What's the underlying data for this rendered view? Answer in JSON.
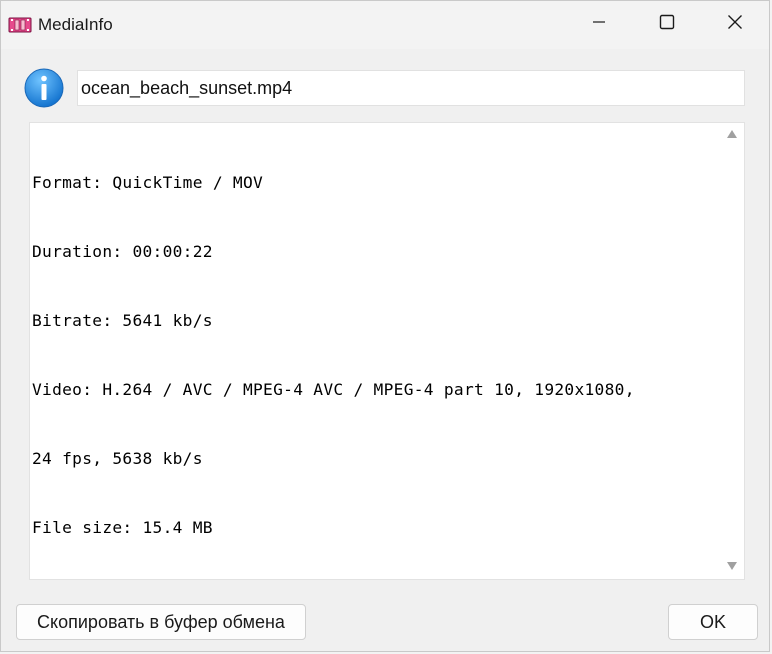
{
  "window": {
    "title": "MediaInfo"
  },
  "file": {
    "name": "ocean_beach_sunset.mp4"
  },
  "info_lines": [
    "Format: QuickTime / MOV",
    "Duration: 00:00:22",
    "Bitrate: 5641 kb/s",
    "Video: H.264 / AVC / MPEG-4 AVC / MPEG-4 part 10, 1920x1080,",
    "24 fps, 5638 kb/s",
    "File size: 15.4 MB"
  ],
  "buttons": {
    "copy_label": "Скопировать в буфер обмена",
    "ok_label": "OK"
  },
  "icons": {
    "app": "film-strip-icon",
    "info": "info-icon",
    "minimize": "minimize-icon",
    "maximize": "maximize-icon",
    "close": "close-icon",
    "scroll_up": "scroll-up-arrow-icon",
    "scroll_down": "scroll-down-arrow-icon"
  },
  "colors": {
    "info_blue": "#2a8ce0",
    "app_icon": "#c2185b"
  }
}
